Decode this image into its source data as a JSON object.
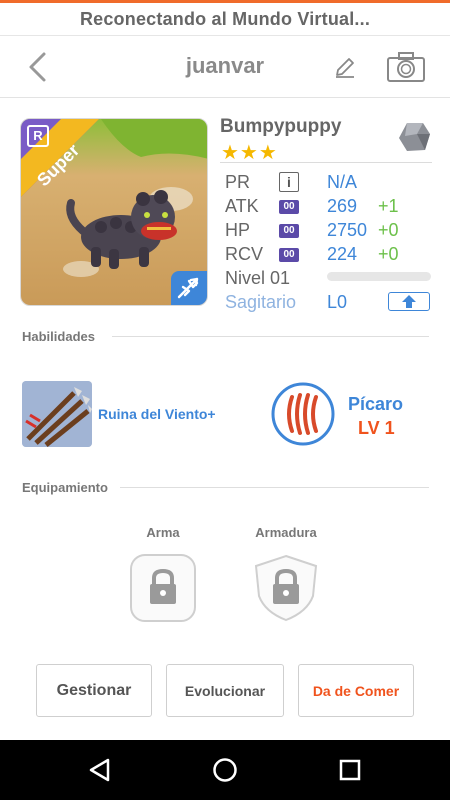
{
  "status": {
    "message": "Reconectando al Mundo Virtual..."
  },
  "header": {
    "title": "juanvar"
  },
  "monster": {
    "name": "Bumpypuppy",
    "rarity_badge": "R",
    "rarity_label": "Super",
    "stars": "★★★",
    "star_count": 3,
    "stats": {
      "pr_label": "PR",
      "pr_value": "N/A",
      "atk_label": "ATK",
      "atk_value": "269",
      "atk_bonus": "+1",
      "hp_label": "HP",
      "hp_value": "2750",
      "hp_bonus": "+0",
      "rcv_label": "RCV",
      "rcv_value": "224",
      "rcv_bonus": "+0",
      "badge_text": "00",
      "info_glyph": "i"
    },
    "level_label": "Nivel 01",
    "exp_progress": 0,
    "sign": "Sagitario",
    "sign_level": "L0"
  },
  "abilities": {
    "label": "Habilidades",
    "skill_name": "Ruina del Viento+",
    "class_name": "Pícaro",
    "class_level": "LV 1"
  },
  "equipment": {
    "label": "Equipamiento",
    "weapon_label": "Arma",
    "armor_label": "Armadura"
  },
  "actions": {
    "manage": "Gestionar",
    "evolve": "Evolucionar",
    "feed": "Da de Comer"
  },
  "colors": {
    "accent": "#f06b2a",
    "blue": "#3e86d8",
    "green": "#6cc04a",
    "orange_text": "#f0531d",
    "star": "#f5b800"
  }
}
